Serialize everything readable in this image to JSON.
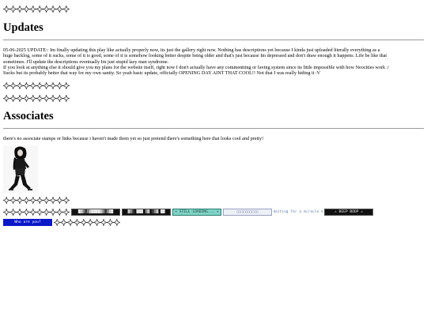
{
  "decoration": {
    "divider_icon": "sparkle-star-icon",
    "divider_color": "#222222"
  },
  "updates": {
    "heading": "Updates",
    "lines": [
      "05-06-2025 UPDATE:: Im finally updating this play like actually properly now, its just the gallery right now. Nothing has descriptions yet because I kinda just uploaded literally everything as a",
      "huge backlog, some of it sucks, some of it is good, some of it is somehow looking better despite being older and that's just because Im depressed and don't draw enough it happens. Life be like that",
      "sometimes. I'll update the descriptions eventually Im just stupid lazy man syndrome.",
      "If you look at anything else it should give you my plans for the website itself, right now I don't actually have any commentting or faving system since its little impossible with how Neocities work :/",
      "Sucks but its probably better that way for my own sanity. So yeah basic update, officially OPENING DAY AINT THAT COOL!! Not that I was really hiding it :V"
    ]
  },
  "associates": {
    "heading": "Associates",
    "text": "there's no associate stamps or links because i haven't made them yet so just pretend there's something here that looks cool and pretty!"
  },
  "stamps": [
    {
      "label": "█▓▒░▒▓████▓▒░▒▓█",
      "style": "dark"
    },
    {
      "label": "▓▒░ ███ ▒▓ ░▒▓ ██",
      "style": "dark"
    },
    {
      "label": "✦ STILL LOADING... ✦",
      "style": "teal"
    },
    {
      "label": "▢▢▢▢▢▢▢▢▢▢",
      "style": "lilac"
    },
    {
      "label": "Waiting for a miracle ❄",
      "style": "plain"
    },
    {
      "label": "⚠ BEEP BOOP ⚠",
      "style": "dark"
    },
    {
      "label": "Who are you?",
      "style": "blue"
    }
  ]
}
